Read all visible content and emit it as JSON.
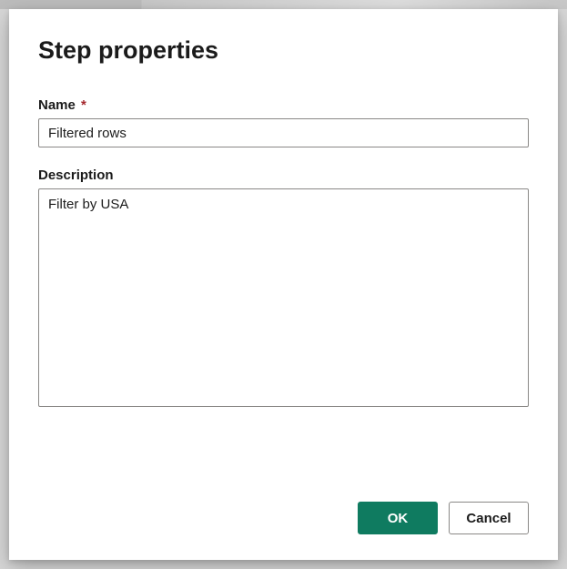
{
  "dialog": {
    "title": "Step properties",
    "fields": {
      "name": {
        "label": "Name",
        "required_marker": "*",
        "value": "Filtered rows"
      },
      "description": {
        "label": "Description",
        "value": "Filter by USA"
      }
    },
    "buttons": {
      "ok": "OK",
      "cancel": "Cancel"
    }
  }
}
